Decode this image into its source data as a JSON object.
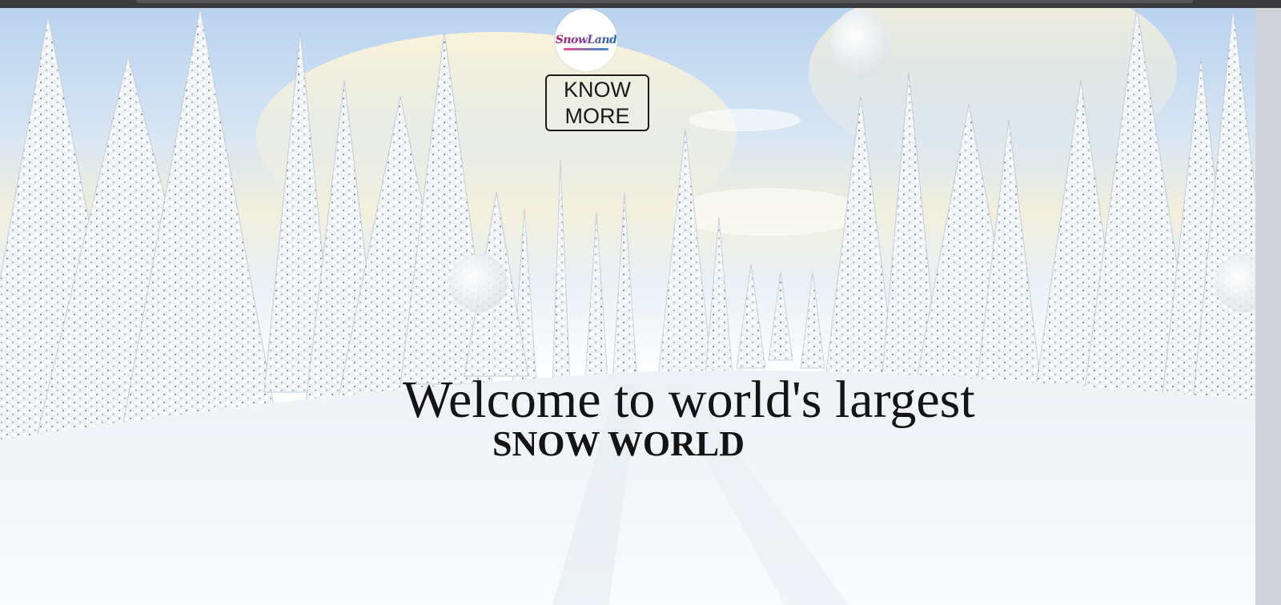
{
  "logo": {
    "text": "SnowLand",
    "icon": "snowland-logo"
  },
  "cta": {
    "label": "KNOW MORE"
  },
  "hero": {
    "headline": "Welcome to world's largest",
    "subheadline": "SNOW WORLD",
    "background": "snowy-pine-forest-photo"
  },
  "colors": {
    "text": "#141414",
    "sky": "#b9d3ef",
    "snow": "#f7f9fb",
    "pine": "#2f3b45"
  }
}
